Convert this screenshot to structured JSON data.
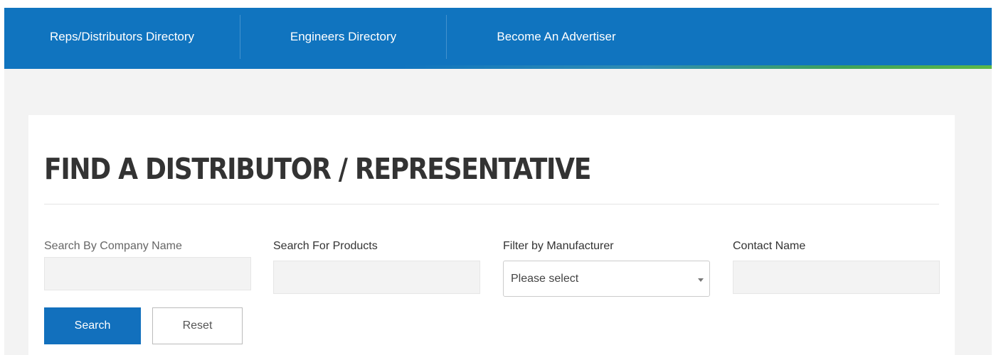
{
  "nav": {
    "items": [
      {
        "label": "Reps/Distributors Directory"
      },
      {
        "label": "Engineers Directory"
      },
      {
        "label": "Become An Advertiser"
      }
    ]
  },
  "main": {
    "title": "FIND A DISTRIBUTOR / REPRESENTATIVE",
    "fields": {
      "company": {
        "label": "Search By Company Name",
        "value": ""
      },
      "products": {
        "label": "Search For Products",
        "value": ""
      },
      "manufacturer": {
        "label": "Filter by Manufacturer",
        "selected": "Please select"
      },
      "contact": {
        "label": "Contact Name",
        "value": ""
      }
    },
    "buttons": {
      "search": "Search",
      "reset": "Reset"
    }
  },
  "colors": {
    "nav_bg": "#1074bf",
    "accent_green": "#5cb848",
    "button_primary": "#1270bd",
    "page_bg": "#f3f3f3"
  },
  "icons": {
    "select_caret": "chevron-down-icon"
  }
}
